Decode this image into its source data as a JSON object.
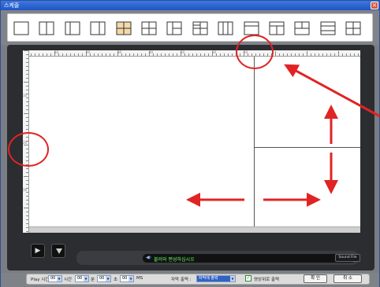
{
  "window": {
    "title": "스케줄",
    "close_glyph": "×"
  },
  "toolbar": {
    "layouts": [
      {
        "name": "layout-single"
      },
      {
        "name": "layout-two-vertical"
      },
      {
        "name": "layout-side-panel"
      },
      {
        "name": "layout-two-wide"
      },
      {
        "name": "layout-grid-selected",
        "selected": true
      },
      {
        "name": "layout-center-cross"
      },
      {
        "name": "layout-three-right"
      },
      {
        "name": "layout-four-grid"
      },
      {
        "name": "layout-three-columns"
      },
      {
        "name": "layout-top-banner"
      },
      {
        "name": "layout-banner-split"
      },
      {
        "name": "layout-t-split"
      },
      {
        "name": "layout-three-rows"
      },
      {
        "name": "layout-quad-alt"
      }
    ]
  },
  "ruler": {
    "top_marks": [
      "10",
      "20",
      "30",
      "40",
      "50",
      "60",
      "70"
    ],
    "left_marks": [
      "10",
      "20",
      "30"
    ]
  },
  "player": {
    "play_glyph": "▶",
    "speaker_glyph": "◀›",
    "message": "불러와 편성하십시오",
    "sound_file": "Sound File"
  },
  "status": {
    "play_time_label": "Play 시간 :",
    "hour_label": "시간",
    "minute_label": "분",
    "second_label": "초",
    "ms_label": "MS",
    "hour_value": "00",
    "h2_value": "00",
    "minute_value": "00",
    "second_value": "00",
    "caption_label": "자막 출력 :",
    "caption_value": "자막에 출력",
    "mirror_label": "영상위로 출력",
    "mirror_checked": "✓",
    "ok_label": "확 인",
    "cancel_label": "취 소"
  },
  "colors": {
    "annotation_red": "#e02424",
    "selected_layout": "#f4d9a8",
    "title_bar": "#1f55c6"
  }
}
